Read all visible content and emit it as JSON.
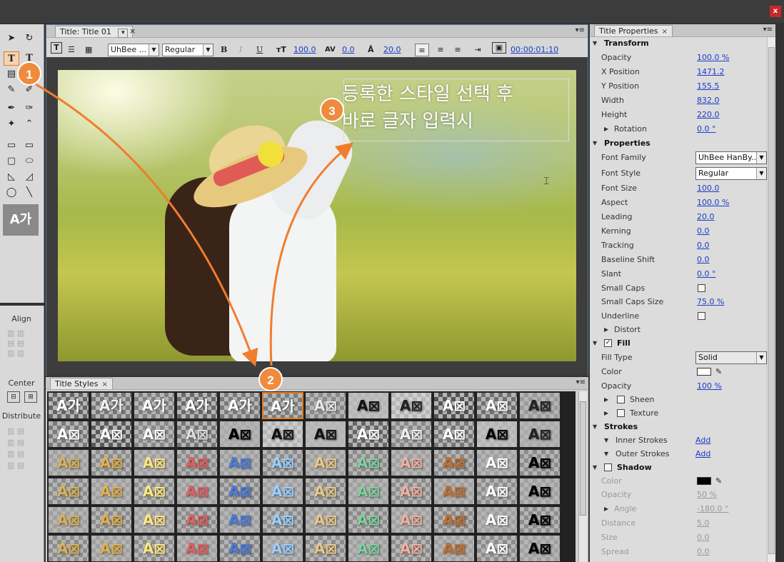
{
  "window": {
    "close_glyph": "x"
  },
  "title_panel": {
    "tab_label": "Title: Title 01",
    "tab_dropdown_glyph": "▾",
    "tab_close": "×",
    "font_family": "UhBee ...",
    "font_style": "Regular",
    "bold": "B",
    "italic": "I",
    "underline": "U",
    "font_size": "100.0",
    "kerning": "0.0",
    "leading": "20.0",
    "timecode": "00:00:01;10",
    "caption_line1": "등록한 스타일 선택 후",
    "caption_line2": "바로 글자 입력시"
  },
  "tools": {
    "style_preview": "A가"
  },
  "alignment": {
    "align_label": "Align",
    "center_label": "Center",
    "distribute_label": "Distribute"
  },
  "title_styles": {
    "tab_label": "Title Styles",
    "tab_close": "×",
    "swatches": [
      "A가",
      "A가",
      "A가",
      "A가",
      "A가",
      "A가",
      "A⊠",
      "A⊠",
      "A⊠",
      "A⊠",
      "A⊠",
      "A⊠",
      "A⊠",
      "A⊠",
      "A⊠",
      "A⊠",
      "A⊠",
      "A⊠",
      "A⊠",
      "A⊠",
      "A⊠",
      "A⊠",
      "A⊠",
      "A⊠",
      "A⊠",
      "A⊠",
      "A⊠",
      "A⊠",
      "A⊠",
      "A⊠",
      "A⊠",
      "A⊠",
      "A⊠",
      "A⊠",
      "A⊠",
      "A⊠",
      "A⊠",
      "A⊠",
      "A⊠",
      "A⊠",
      "A⊠",
      "A⊠",
      "A⊠",
      "A⊠",
      "A⊠",
      "A⊠",
      "A⊠",
      "A⊠",
      "A⊠",
      "A⊠",
      "A⊠",
      "A⊠",
      "A⊠",
      "A⊠",
      "A⊠",
      "A⊠",
      "A⊠",
      "A⊠",
      "A⊠",
      "A⊠",
      "A⊠",
      "A⊠",
      "A⊠",
      "A⊠",
      "A⊠",
      "A⊠",
      "A⊠",
      "A⊠",
      "A⊠",
      "A⊠",
      "A⊠",
      "A⊠"
    ],
    "selected_index": 5
  },
  "properties": {
    "tab_label": "Title Properties",
    "tab_close": "×",
    "transform_label": "Transform",
    "opacity_label": "Opacity",
    "opacity": "100.0 %",
    "xpos_label": "X Position",
    "xpos": "1471.2",
    "ypos_label": "Y Position",
    "ypos": "155.5",
    "width_label": "Width",
    "width": "832.0",
    "height_label": "Height",
    "height": "220.0",
    "rotation_label": "Rotation",
    "rotation": "0.0 °",
    "properties_label": "Properties",
    "font_family_label": "Font Family",
    "font_family": "UhBee HanBy...",
    "font_style_label": "Font Style",
    "font_style": "Regular",
    "font_size_label": "Font Size",
    "font_size": "100.0",
    "aspect_label": "Aspect",
    "aspect": "100.0 %",
    "leading_label": "Leading",
    "leading": "20.0",
    "kerning_label": "Kerning",
    "kerning": "0.0",
    "tracking_label": "Tracking",
    "tracking": "0.0",
    "baseline_label": "Baseline Shift",
    "baseline": "0.0",
    "slant_label": "Slant",
    "slant": "0.0 °",
    "small_caps_label": "Small Caps",
    "small_caps_size_label": "Small Caps Size",
    "small_caps_size": "75.0 %",
    "underline_label": "Underline",
    "distort_label": "Distort",
    "fill_label": "Fill",
    "fill_type_label": "Fill Type",
    "fill_type": "Solid",
    "color_label": "Color",
    "fill_opacity_label": "Opacity",
    "fill_opacity": "100 %",
    "sheen_label": "Sheen",
    "texture_label": "Texture",
    "strokes_label": "Strokes",
    "inner_strokes_label": "Inner Strokes",
    "inner_strokes": "Add",
    "outer_strokes_label": "Outer Strokes",
    "outer_strokes": "Add",
    "shadow_label": "Shadow",
    "shadow_color_label": "Color",
    "shadow_opacity_label": "Opacity",
    "shadow_opacity": "50 %",
    "angle_label": "Angle",
    "angle": "-180.0 °",
    "distance_label": "Distance",
    "distance": "5.0",
    "size_label": "Size",
    "size": "0.0",
    "spread_label": "Spread",
    "spread": "0.0",
    "fill_color": "#ffffff",
    "shadow_color": "#000000"
  },
  "annotations": {
    "badge1": "1",
    "badge2": "2",
    "badge3": "3",
    "arrow_color": "#f07d2e"
  }
}
